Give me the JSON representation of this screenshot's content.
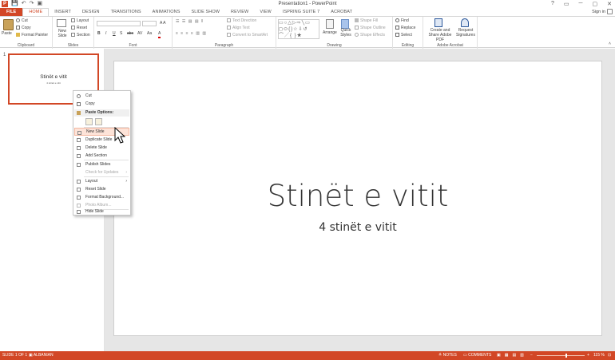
{
  "window": {
    "title": "Presentation1 - PowerPoint",
    "controls": [
      "?",
      "▭",
      "─",
      "▢",
      "✕"
    ]
  },
  "qat": {
    "logo": "P",
    "items": [
      "save-icon",
      "undo-icon",
      "redo-icon",
      "start-from-beginning-icon"
    ]
  },
  "tabs": [
    "FILE",
    "HOME",
    "INSERT",
    "DESIGN",
    "TRANSITIONS",
    "ANIMATIONS",
    "SLIDE SHOW",
    "REVIEW",
    "VIEW",
    "ISPRING SUITE 7",
    "ACROBAT"
  ],
  "signin": "Sign in",
  "ribbon": {
    "clipboard": {
      "label": "Clipboard",
      "paste": "Paste",
      "cut": "Cut",
      "copy": "Copy",
      "format_painter": "Format Painter"
    },
    "slides": {
      "label": "Slides",
      "new_slide": "New Slide",
      "layout": "Layout",
      "reset": "Reset",
      "section": "Section"
    },
    "font": {
      "label": "Font",
      "buttons": [
        "B",
        "I",
        "U",
        "S",
        "abc",
        "AV",
        "Aa",
        "A"
      ]
    },
    "paragraph": {
      "label": "Paragraph",
      "text_direction": "Text Direction",
      "align_text": "Align Text",
      "convert_smartart": "Convert to SmartArt"
    },
    "drawing": {
      "label": "Drawing",
      "arrange": "Arrange",
      "quick_styles": "Quick Styles",
      "shape_fill": "Shape Fill",
      "shape_outline": "Shape Outline",
      "shape_effects": "Shape Effects"
    },
    "editing": {
      "label": "Editing",
      "find": "Find",
      "replace": "Replace",
      "select": "Select"
    },
    "acrobat": {
      "label": "Adobe Acrobat",
      "create_share": "Create and Share Adobe PDF",
      "request_signatures": "Request Signatures"
    }
  },
  "thumbnail": {
    "number": "1",
    "title": "Stinët e vitit",
    "subtitle": "4 stinët e vitit"
  },
  "slide": {
    "title": "Stinët e vitit",
    "subtitle": "4 stinët e vitit"
  },
  "context_menu": {
    "cut": "Cut",
    "copy": "Copy",
    "paste_options": "Paste Options:",
    "new_slide": "New Slide",
    "duplicate_slide": "Duplicate Slide",
    "delete_slide": "Delete Slide",
    "add_section": "Add Section",
    "publish_slides": "Publish Slides",
    "check_updates": "Check for Updates",
    "layout": "Layout",
    "reset_slide": "Reset Slide",
    "format_background": "Format Background...",
    "photo_album": "Photo Album...",
    "hide_slide": "Hide Slide"
  },
  "status": {
    "slide_of": "SLIDE 1 OF 1",
    "language": "ALBANIAN",
    "notes": "NOTES",
    "comments": "COMMENTS",
    "zoom": "115 %"
  },
  "colors": {
    "accent": "#d24726",
    "highlight": "#fde3d8"
  }
}
